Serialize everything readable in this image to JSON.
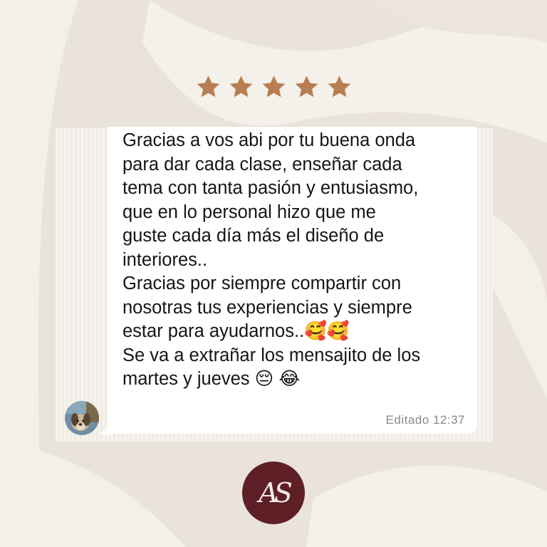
{
  "rating": {
    "stars": 5,
    "max_stars": 5,
    "star_color": "#b77e52",
    "icon": "star-icon"
  },
  "chat": {
    "avatar_icon": "dog-photo-avatar",
    "lines": [
      "Gracias a vos abi por tu buena onda",
      "para dar cada clase, enseñar cada",
      "tema con tanta pasión y entusiasmo,",
      "que en lo personal hizo que me",
      "guste cada día más el diseño de",
      "interiores..",
      "Gracias por siempre compartir con",
      "nosotras tus experiencias y siempre",
      "estar para ayudarnos.."
    ],
    "line_emojis": [
      "🥰",
      "🥰"
    ],
    "line_10": "Se va a extrañar los mensajito de los",
    "line_11": "martes y jueves ",
    "line_11_emojis": [
      "😔",
      "😂"
    ],
    "edited_label": "Editado",
    "time": "12:37"
  },
  "brand": {
    "logo_text": "AS",
    "logo_color": "#5e1f27"
  },
  "colors": {
    "background": "#eae3dc",
    "bubble": "#ffffff",
    "text": "#151515",
    "meta": "#8a8a8a"
  }
}
